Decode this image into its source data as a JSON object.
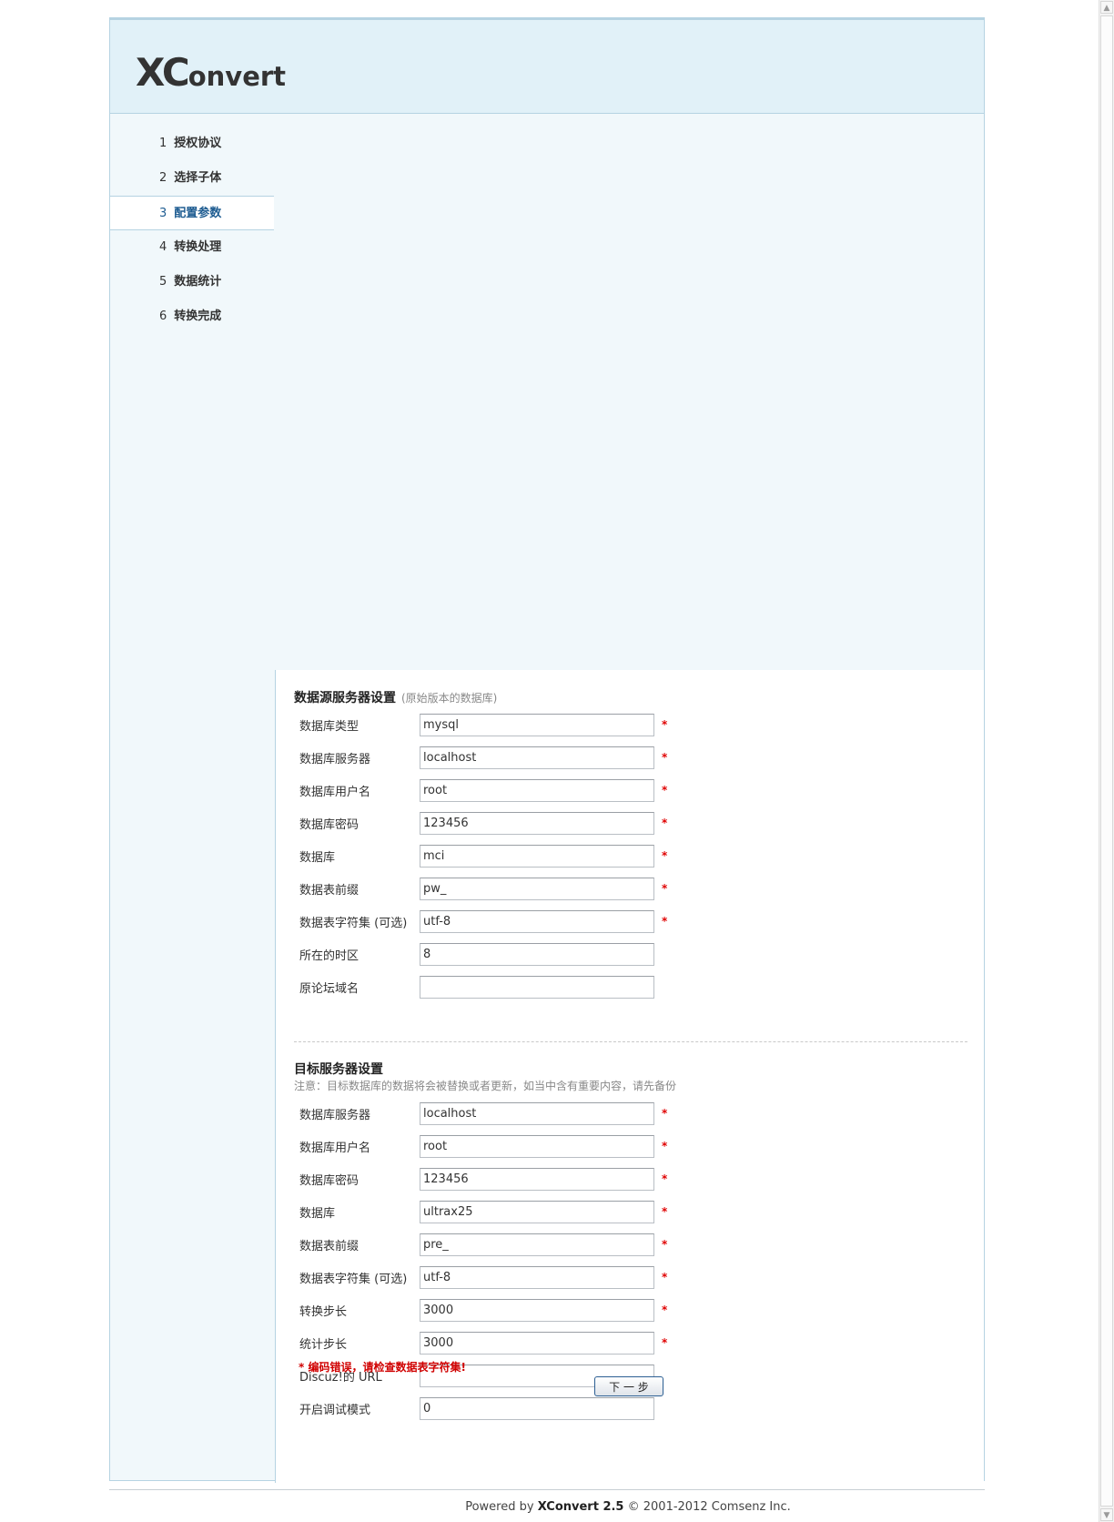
{
  "logo": {
    "big": "XC",
    "rest": "onvert"
  },
  "nav": [
    {
      "num": "1",
      "label": "授权协议"
    },
    {
      "num": "2",
      "label": "选择子体"
    },
    {
      "num": "3",
      "label": "配置参数"
    },
    {
      "num": "4",
      "label": "转换处理"
    },
    {
      "num": "5",
      "label": "数据统计"
    },
    {
      "num": "6",
      "label": "转换完成"
    }
  ],
  "source": {
    "title": "数据源服务器设置",
    "subtitle": "(原始版本的数据库)",
    "fields": [
      {
        "label": "数据库类型",
        "value": "mysql",
        "required": "*"
      },
      {
        "label": "数据库服务器",
        "value": "localhost",
        "required": "*"
      },
      {
        "label": "数据库用户名",
        "value": "root",
        "required": "*"
      },
      {
        "label": "数据库密码",
        "value": "123456",
        "required": "*"
      },
      {
        "label": "数据库",
        "value": "mci",
        "required": "*"
      },
      {
        "label": "数据表前缀",
        "value": "pw_",
        "required": "*"
      },
      {
        "label": "数据表字符集 (可选)",
        "value": "utf-8",
        "required": "*"
      },
      {
        "label": "所在的时区",
        "value": "8",
        "required": ""
      },
      {
        "label": "原论坛域名",
        "value": "",
        "required": ""
      }
    ]
  },
  "target": {
    "title": "目标服务器设置",
    "note": "注意：目标数据库的数据将会被替换或者更新，如当中含有重要内容，请先备份",
    "fields": [
      {
        "label": "数据库服务器",
        "value": "localhost",
        "required": "*"
      },
      {
        "label": "数据库用户名",
        "value": "root",
        "required": "*"
      },
      {
        "label": "数据库密码",
        "value": "123456",
        "required": "*"
      },
      {
        "label": "数据库",
        "value": "ultrax25",
        "required": "*"
      },
      {
        "label": "数据表前缀",
        "value": "pre_",
        "required": "*"
      },
      {
        "label": "数据表字符集 (可选)",
        "value": "utf-8",
        "required": "*"
      },
      {
        "label": "转换步长",
        "value": "3000",
        "required": "*"
      },
      {
        "label": "统计步长",
        "value": "3000",
        "required": "*"
      },
      {
        "label": "Discuz!的 URL",
        "value": "",
        "required": ""
      },
      {
        "label": "开启调试模式",
        "value": "0",
        "required": ""
      }
    ]
  },
  "error": "* 编码错误，请检查数据表字符集!",
  "next_button": "下 一 步",
  "footer": {
    "prefix": "Powered by",
    "product": "XConvert 2.5",
    "copyright": "© 2001-2012 Comsenz Inc."
  },
  "scrollbar": {
    "up": "▲",
    "down": "▼"
  }
}
